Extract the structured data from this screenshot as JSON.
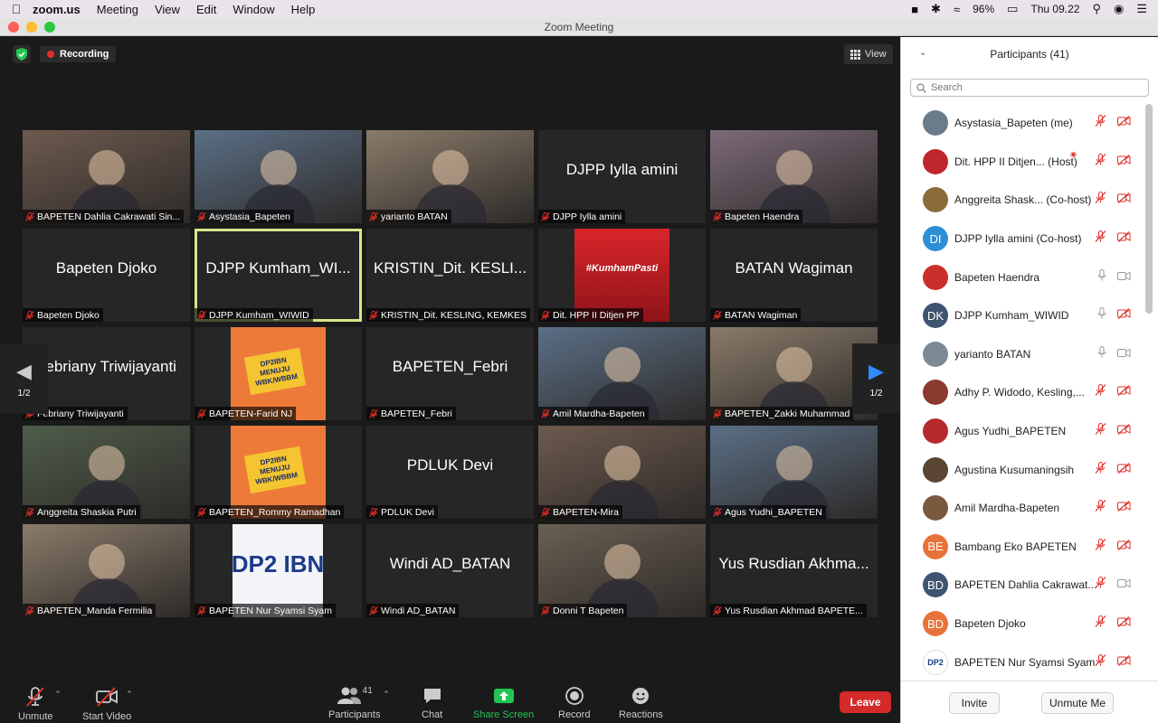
{
  "menubar": {
    "app": "zoom.us",
    "items": [
      "Meeting",
      "View",
      "Edit",
      "Window",
      "Help"
    ],
    "battery": "96%",
    "clock": "Thu 09.22"
  },
  "window": {
    "title": "Zoom Meeting"
  },
  "meeting": {
    "recording_label": "Recording",
    "view_label": "View",
    "page_indicator": "1/2",
    "tiles": [
      {
        "name": "BAPETEN Dahlia Cakrawati Sin...",
        "big": "",
        "video": "photo"
      },
      {
        "name": "Asystasia_Bapeten",
        "big": "",
        "video": "photo"
      },
      {
        "name": "yarianto BATAN",
        "big": "",
        "video": "photo"
      },
      {
        "name": "DJPP Iylla amini",
        "big": "DJPP Iylla amini",
        "video": ""
      },
      {
        "name": "Bapeten Haendra",
        "big": "",
        "video": "photo"
      },
      {
        "name": "Bapeten Djoko",
        "big": "Bapeten Djoko",
        "video": ""
      },
      {
        "name": "DJPP Kumham_WIWID",
        "big": "DJPP Kumham_WI...",
        "video": "",
        "active": true
      },
      {
        "name": "KRISTIN_Dit. KESLING, KEMKES",
        "big": "KRISTIN_Dit. KESLI...",
        "video": ""
      },
      {
        "name": "Dit. HPP II Ditjen PP",
        "big": "#KumhamPasti",
        "video": "red"
      },
      {
        "name": "BATAN Wagiman",
        "big": "BATAN Wagiman",
        "video": ""
      },
      {
        "name": "Febriany Triwijayanti",
        "big": "Febriany Triwijayanti",
        "video": ""
      },
      {
        "name": "BAPETEN-Farid NJ",
        "big": "",
        "video": "orange"
      },
      {
        "name": "BAPETEN_Febri",
        "big": "BAPETEN_Febri",
        "video": ""
      },
      {
        "name": "Amil Mardha-Bapeten",
        "big": "",
        "video": "photo"
      },
      {
        "name": "BAPETEN_Zakki Muhammad",
        "big": "",
        "video": "photo"
      },
      {
        "name": "Anggreita Shaskia Putri",
        "big": "",
        "video": "photo"
      },
      {
        "name": "BAPETEN_Rommy Ramadhan",
        "big": "",
        "video": "orange"
      },
      {
        "name": "PDLUK Devi",
        "big": "PDLUK Devi",
        "video": ""
      },
      {
        "name": "BAPETEN-Mira",
        "big": "",
        "video": "photo"
      },
      {
        "name": "Agus Yudhi_BAPETEN",
        "big": "",
        "video": "photo"
      },
      {
        "name": "BAPETEN_Manda Fermilia",
        "big": "",
        "video": "photo"
      },
      {
        "name": "BAPETEN Nur Syamsi Syam",
        "big": "DP2 IBN",
        "video": "logo"
      },
      {
        "name": "Windi AD_BATAN",
        "big": "Windi AD_BATAN",
        "video": ""
      },
      {
        "name": "Donni T Bapeten",
        "big": "",
        "video": "photo"
      },
      {
        "name": "Yus Rusdian Akhmad BAPETE...",
        "big": "Yus Rusdian Akhma...",
        "video": ""
      }
    ],
    "tile_poster_text": "DP2IBN MENUJU WBK/WBBM"
  },
  "toolbar": {
    "unmute": "Unmute",
    "start_video": "Start Video",
    "participants": "Participants",
    "participants_count": "41",
    "chat": "Chat",
    "share_screen": "Share Screen",
    "record": "Record",
    "reactions": "Reactions",
    "leave": "Leave"
  },
  "panel": {
    "title": "Participants (41)",
    "search_placeholder": "Search",
    "invite": "Invite",
    "unmute_me": "Unmute Me",
    "participants": [
      {
        "name": "Asystasia_Bapeten",
        "role": "(me)",
        "initials": "",
        "color": "#6a7b8c",
        "mic": "muted",
        "cam": "off"
      },
      {
        "name": "Dit. HPP II Ditjen...",
        "role": "(Host)",
        "initials": "",
        "color": "#c0272d",
        "mic": "muted",
        "cam": "off"
      },
      {
        "name": "Anggreita Shask...",
        "role": "(Co-host)",
        "initials": "",
        "color": "#8a6d3b",
        "mic": "muted",
        "cam": "off"
      },
      {
        "name": "DJPP Iylla amini",
        "role": "(Co-host)",
        "initials": "DI",
        "color": "#2d8fd5",
        "mic": "muted",
        "cam": "off"
      },
      {
        "name": "Bapeten Haendra",
        "role": "",
        "initials": "",
        "color": "#c9302c",
        "mic": "on",
        "cam": "on"
      },
      {
        "name": "DJPP Kumham_WIWID",
        "role": "",
        "initials": "DK",
        "color": "#3e5470",
        "mic": "on",
        "cam": "off"
      },
      {
        "name": "yarianto BATAN",
        "role": "",
        "initials": "",
        "color": "#7d8a96",
        "mic": "on",
        "cam": "on"
      },
      {
        "name": "Adhy P. Widodo, Kesling,...",
        "role": "",
        "initials": "",
        "color": "#8b3a2f",
        "mic": "muted",
        "cam": "off"
      },
      {
        "name": "Agus Yudhi_BAPETEN",
        "role": "",
        "initials": "",
        "color": "#b52b2b",
        "mic": "muted",
        "cam": "off"
      },
      {
        "name": "Agustina Kusumaningsih",
        "role": "",
        "initials": "",
        "color": "#5a4632",
        "mic": "muted",
        "cam": "off"
      },
      {
        "name": "Amil Mardha-Bapeten",
        "role": "",
        "initials": "",
        "color": "#7a5a3e",
        "mic": "muted",
        "cam": "off"
      },
      {
        "name": "Bambang Eko BAPETEN",
        "role": "",
        "initials": "BE",
        "color": "#e8733a",
        "mic": "muted",
        "cam": "off"
      },
      {
        "name": "BAPETEN Dahlia Cakrawat...",
        "role": "",
        "initials": "BD",
        "color": "#3e5470",
        "mic": "muted",
        "cam": "on"
      },
      {
        "name": "Bapeten Djoko",
        "role": "",
        "initials": "BD",
        "color": "#e8733a",
        "mic": "muted",
        "cam": "off"
      },
      {
        "name": "BAPETEN Nur Syamsi Syam",
        "role": "",
        "initials": "DP2",
        "color": "#ffffff",
        "mic": "muted",
        "cam": "off"
      }
    ]
  },
  "colors": {
    "accent_green": "#23c552",
    "leave_red": "#d42a2a",
    "active_tile": "#d6e68a",
    "mute_red": "#e0302a"
  }
}
